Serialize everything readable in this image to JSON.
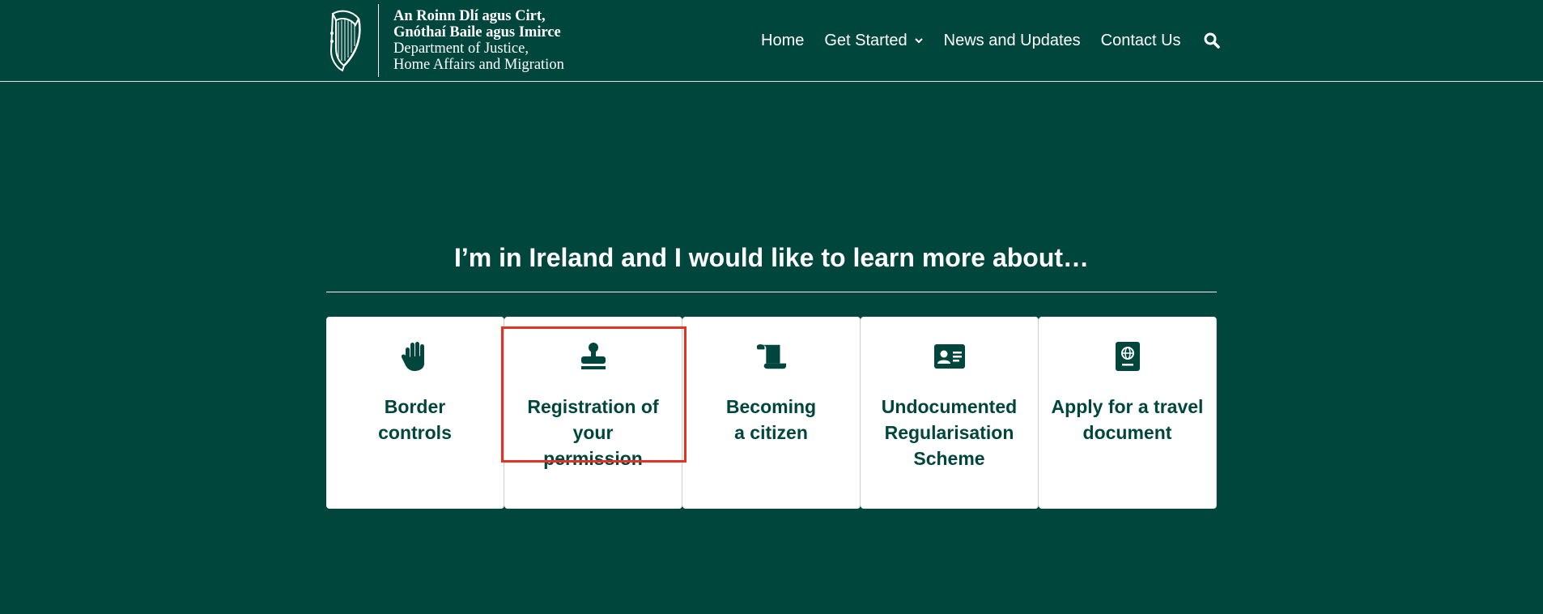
{
  "colors": {
    "brand_green": "#00463d",
    "card_bg": "#ffffff",
    "highlight": "#e53224"
  },
  "logo": {
    "line1": "An Roinn Dlí agus Cirt,",
    "line2": "Gnóthaí Baile agus Imirce",
    "line3": "Department of Justice,",
    "line4": "Home Affairs and Migration",
    "icon": "harp-icon"
  },
  "nav": {
    "items": [
      {
        "label": "Home",
        "active": true
      },
      {
        "label": "Get Started",
        "dropdown": true
      },
      {
        "label": "News and Updates"
      },
      {
        "label": "Contact Us"
      }
    ],
    "search_icon": "search-icon"
  },
  "main": {
    "heading": "I’m in Ireland and I would like to learn more about…",
    "cards": [
      {
        "label": "Border\ncontrols",
        "icon": "hand-icon"
      },
      {
        "label": "Registration of your\npermission",
        "icon": "stamp-icon",
        "highlighted": true
      },
      {
        "label": "Becoming\na citizen",
        "icon": "scroll-icon"
      },
      {
        "label": "Undocumented\nRegularisation\nScheme",
        "icon": "id-card-icon"
      },
      {
        "label": "Apply for a travel\ndocument",
        "icon": "passport-icon"
      }
    ]
  }
}
